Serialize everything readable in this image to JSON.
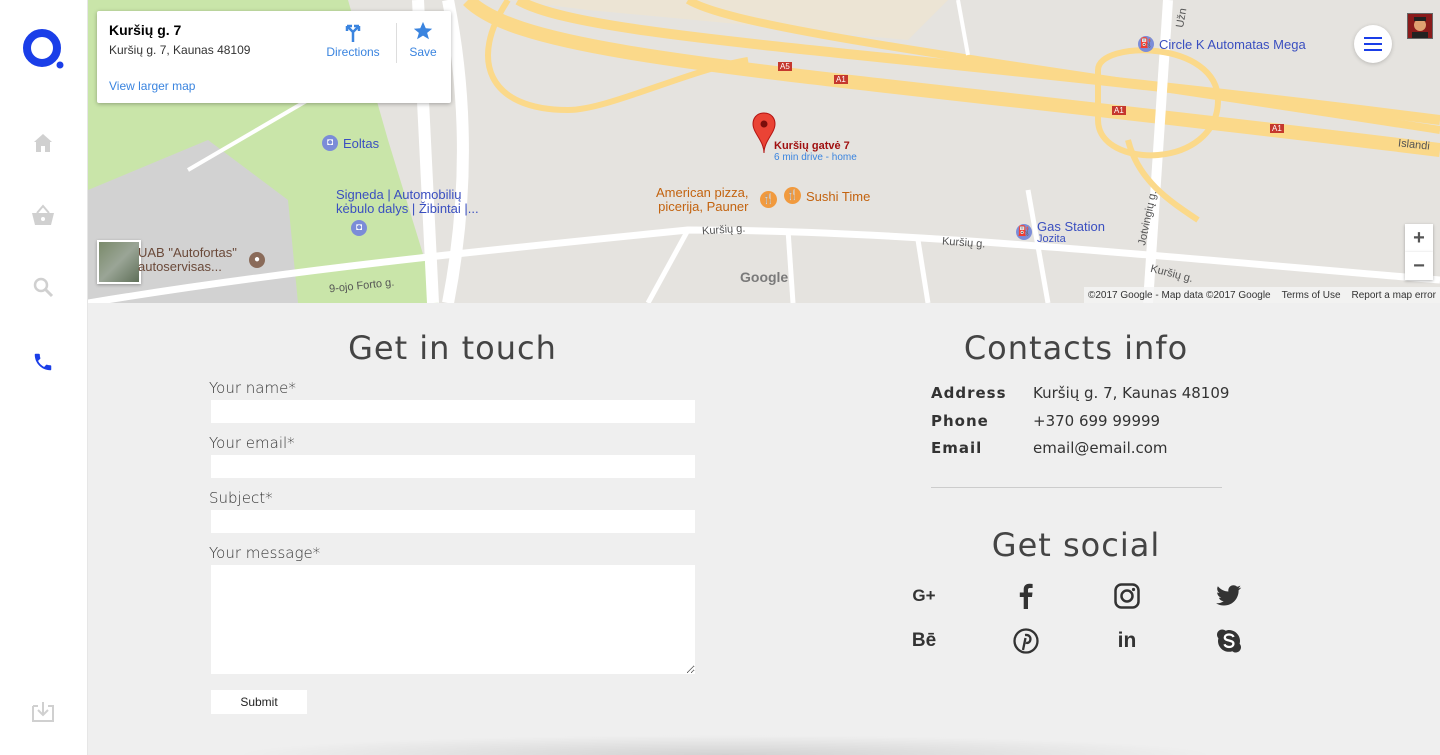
{
  "map": {
    "place_title": "Kuršių g. 7",
    "place_address": "Kuršių g. 7, Kaunas 48109",
    "directions_label": "Directions",
    "save_label": "Save",
    "view_larger_label": "View larger map",
    "marker_title": "Kuršių gatvė 7",
    "marker_subtitle": "6 min drive - home",
    "pois": {
      "circle_k": "Circle K Automatas Mega",
      "eoltas": "Eoltas",
      "signeda": "Signeda | Automobilių\nkėbulo dalys | Žibintai |...",
      "american_pizza": "American pizza,\npicerija, Pauner",
      "sushi_time": "Sushi Time",
      "gas_station": "Gas Station",
      "gas_station_sub": "Jozita",
      "autofortas": "UAB \"Autofortas\"\nautoservisas..."
    },
    "roads": {
      "kursiu_1": "Kuršių g.",
      "kursiu_2": "Kuršių g.",
      "kursiu_3": "Kuršių g.",
      "forto": "9-ojo Forto g.",
      "jotvingiu": "Jotvingių g.",
      "islandijos": "Islandi",
      "uzn": "Užn",
      "a5": "A5",
      "a1_1": "A1",
      "a1_2": "A1",
      "a1_3": "A1"
    },
    "google_logo": "Google",
    "copyright": "©2017 Google - Map data ©2017 Google",
    "terms": "Terms of Use",
    "report": "Report a map error",
    "zoom_in": "+",
    "zoom_out": "−"
  },
  "contact_form": {
    "heading": "Get in touch",
    "name_label": "Your name*",
    "email_label": "Your email*",
    "subject_label": "Subject*",
    "message_label": "Your message*",
    "name_value": "",
    "email_value": "",
    "subject_value": "",
    "message_value": "",
    "submit_label": "Submit"
  },
  "contacts_info": {
    "heading": "Contacts info",
    "rows": [
      {
        "key": "Address",
        "value": "Kuršių g. 7, Kaunas 48109"
      },
      {
        "key": "Phone",
        "value": "+370 699 99999"
      },
      {
        "key": "Email",
        "value": "email@email.com"
      }
    ]
  },
  "social": {
    "heading": "Get social",
    "items": [
      "google-plus-icon",
      "facebook-icon",
      "instagram-icon",
      "twitter-icon",
      "behance-icon",
      "pinterest-icon",
      "linkedin-icon",
      "skype-icon"
    ],
    "google_plus_text": "G+",
    "behance_text": "Bē",
    "linkedin_text": "in"
  },
  "colors": {
    "accent": "#1a3ee8",
    "background": "#efefef",
    "sidebar_icon": "#d0d0d0",
    "map_link": "#3a84df"
  }
}
